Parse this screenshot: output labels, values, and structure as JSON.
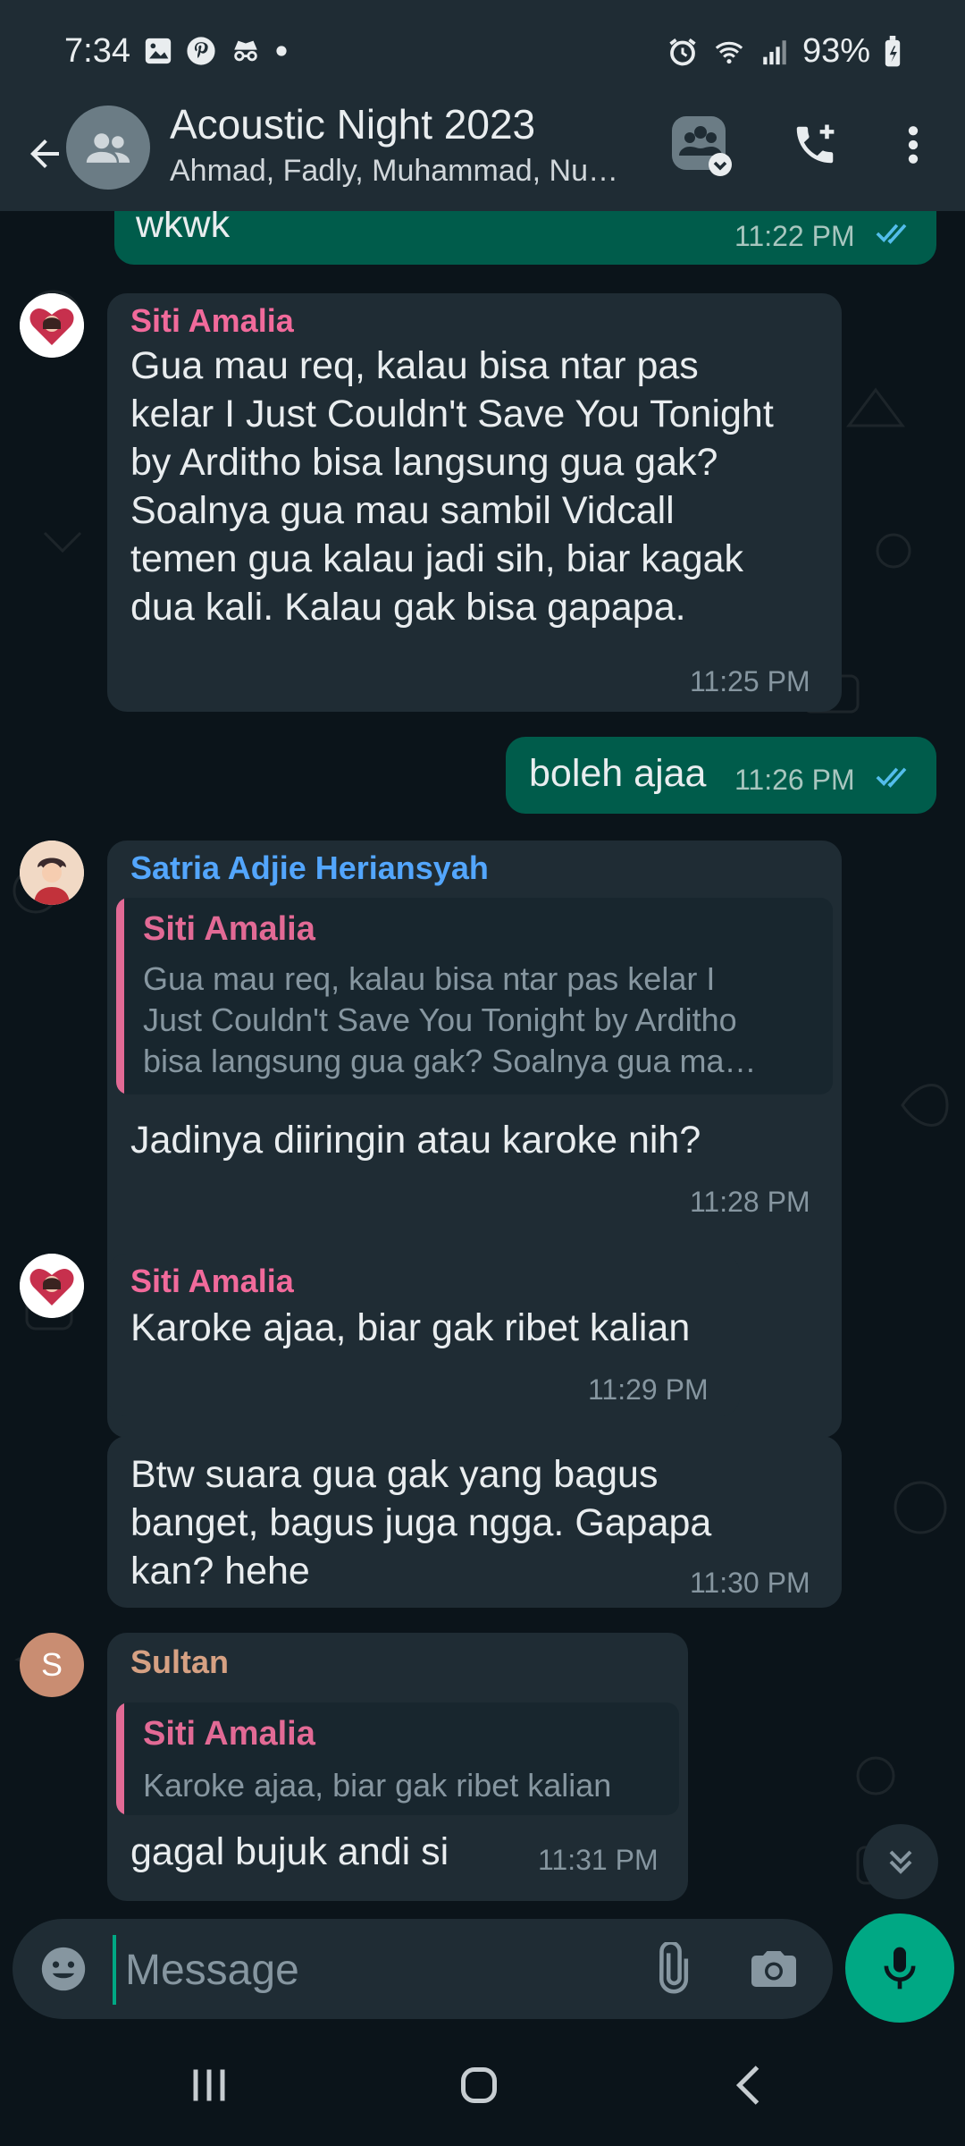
{
  "status_bar": {
    "time": "7:34",
    "battery": "93%"
  },
  "header": {
    "title": "Acoustic Night 2023",
    "subtitle": "Ahmad, Fadly, Muhammad, Nu…"
  },
  "messages": [
    {
      "type": "outgoing",
      "text": "wkwk",
      "time": "11:22 PM"
    },
    {
      "type": "incoming",
      "sender": "Siti Amalia",
      "lines": [
        "Gua mau req, kalau bisa ntar pas",
        "kelar I Just Couldn't Save You Tonight",
        "by Arditho bisa langsung gua gak?",
        "Soalnya gua mau sambil Vidcall",
        "temen gua kalau jadi sih, biar kagak",
        "dua kali. Kalau gak bisa gapapa."
      ],
      "time": "11:25 PM"
    },
    {
      "type": "outgoing",
      "text": "boleh ajaa",
      "time": "11:26 PM"
    },
    {
      "type": "incoming",
      "sender": "Satria Adjie Heriansyah",
      "quote": {
        "name": "Siti Amalia",
        "lines": [
          "Gua mau req, kalau bisa ntar pas kelar I",
          "Just Couldn't Save You Tonight by Arditho",
          "bisa langsung gua gak? Soalnya gua ma…"
        ]
      },
      "text": "Jadinya diiringin atau karoke nih?",
      "time": "11:28 PM"
    },
    {
      "type": "incoming",
      "sender": "Siti Amalia",
      "text": "Karoke ajaa, biar gak ribet kalian",
      "time": "11:29 PM"
    },
    {
      "type": "incoming",
      "lines": [
        "Btw suara gua gak yang bagus",
        "banget, bagus juga ngga. Gapapa",
        "kan? hehe"
      ],
      "time": "11:30 PM"
    },
    {
      "type": "incoming",
      "sender": "Sultan",
      "avatar_letter": "S",
      "quote": {
        "name": "Siti Amalia",
        "lines": [
          "Karoke ajaa, biar gak ribet kalian"
        ]
      },
      "text": "gagal bujuk andi si",
      "time": "11:31 PM"
    }
  ],
  "composer": {
    "placeholder": "Message"
  },
  "colors": {
    "siti": "#f16a9b",
    "satria": "#53a6fd",
    "sultan": "#d6a183",
    "outgoing_bubble": "#005c4b",
    "incoming_bubble": "#1f2c34",
    "accent": "#00a884"
  },
  "icons": [
    "back-arrow-icon",
    "group-avatar-icon",
    "community-icon",
    "add-call-icon",
    "more-vert-icon",
    "emoji-icon",
    "attach-icon",
    "camera-icon",
    "mic-icon",
    "double-chevron-down-icon",
    "recent-apps-icon",
    "home-icon",
    "nav-back-icon"
  ]
}
